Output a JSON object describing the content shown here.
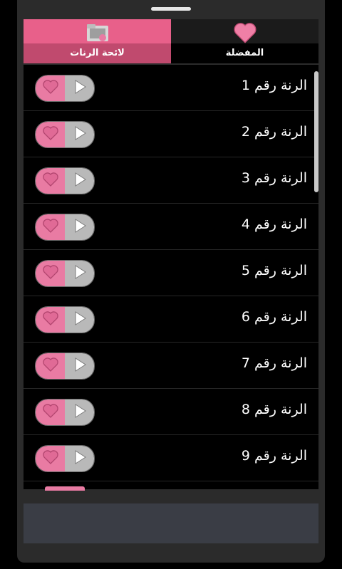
{
  "tabs": {
    "playlist_label": "لائحة الرنات",
    "favorites_label": "المفضلة",
    "playlist_icon": "folder-icon",
    "favorites_icon": "heart-icon"
  },
  "rows": [
    "الرنة رقم 1",
    "الرنة رقم 2",
    "الرنة رقم 3",
    "الرنة رقم 4",
    "الرنة رقم 5",
    "الرنة رقم 6",
    "الرنة رقم 7",
    "الرنة رقم 8",
    "الرنة رقم 9"
  ],
  "colors": {
    "accent_pink": "#e8608a",
    "heart_pink": "#e97ba3",
    "play_grey": "#b9b9b9",
    "background": "#000000"
  }
}
